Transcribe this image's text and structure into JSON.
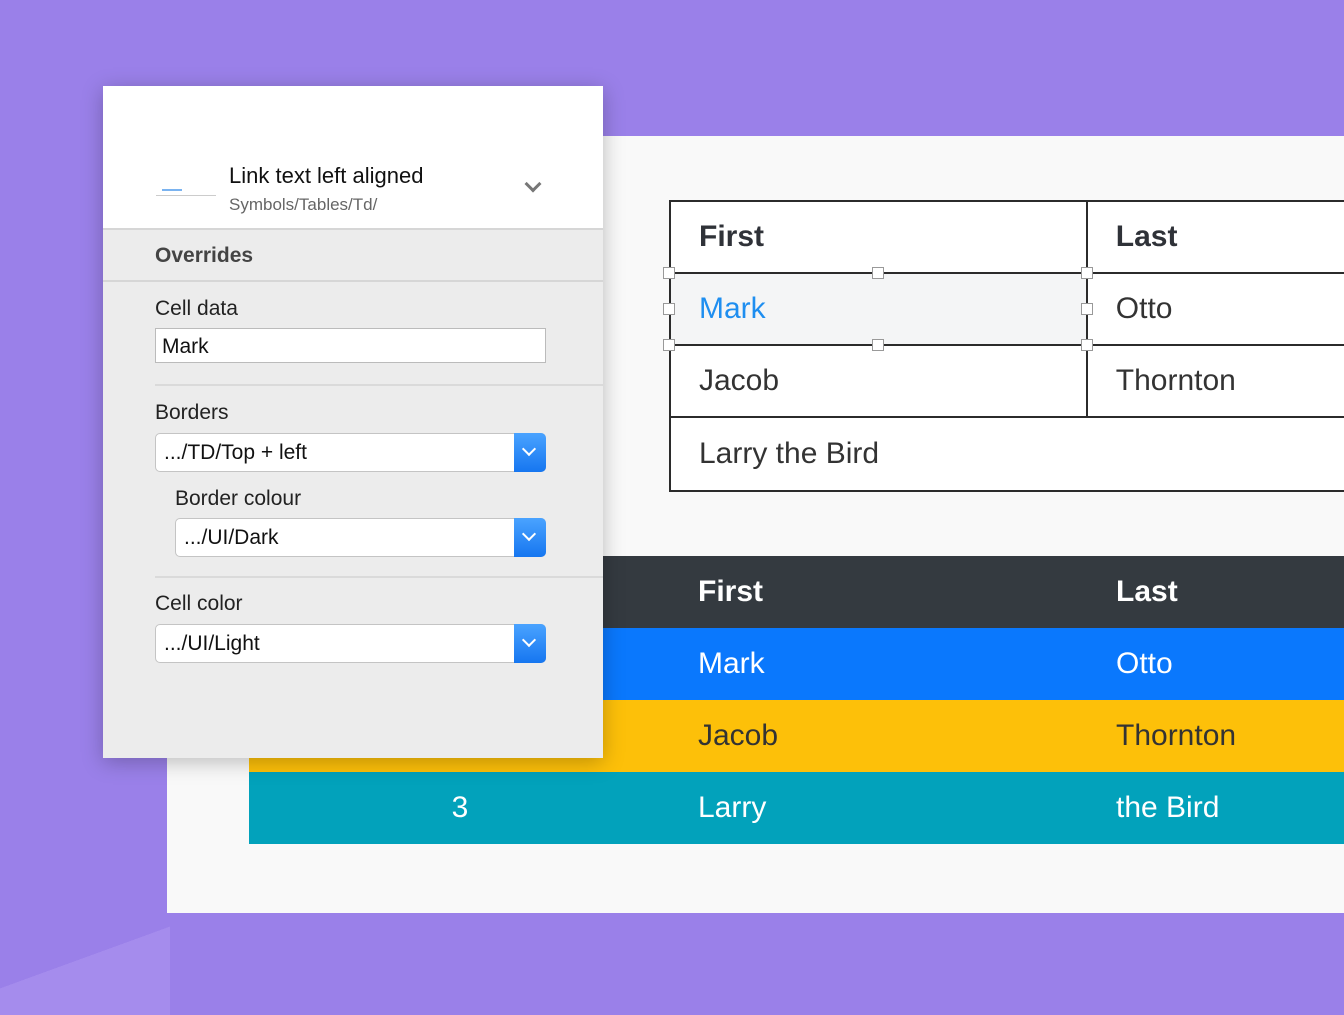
{
  "panel": {
    "title": "Link text left aligned",
    "path": "Symbols/Tables/Td/",
    "overrides": "Overrides",
    "cell_data_label": "Cell data",
    "cell_data_value": "Mark",
    "borders_label": "Borders",
    "borders_value": ".../TD/Top + left",
    "border_colour_label": "Border colour",
    "border_colour_value": ".../UI/Dark",
    "cell_color_label": "Cell color",
    "cell_color_value": ".../UI/Light"
  },
  "table1": {
    "headers": [
      "First",
      "Last"
    ],
    "rows": [
      [
        "Mark",
        "Otto"
      ],
      [
        "Jacob",
        "Thornton"
      ],
      [
        "Larry the Bird"
      ]
    ]
  },
  "table2": {
    "headers": [
      "",
      "First",
      "Last"
    ],
    "rows": [
      [
        "",
        "Mark",
        "Otto"
      ],
      [
        "",
        "Jacob",
        "Thornton"
      ],
      [
        "3",
        "Larry",
        "the Bird"
      ]
    ]
  },
  "colors": {
    "background": "#9a80e9",
    "dark": "#343a40",
    "primary": "#0a78fd",
    "warning": "#fdc009",
    "info": "#02a2bb",
    "link": "#1e8ef0"
  }
}
